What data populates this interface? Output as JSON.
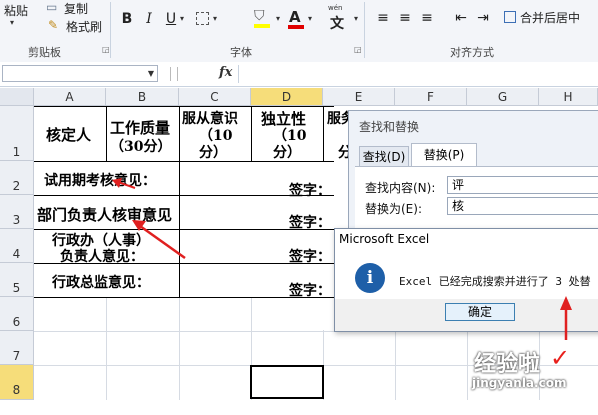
{
  "ribbon": {
    "clipboard": {
      "copy_label": "复制",
      "paste_label": "粘贴",
      "format_painter_label": "格式刷",
      "group_label": "剪贴板"
    },
    "font": {
      "bold": "B",
      "italic": "I",
      "underline": "U",
      "font_color_glyph": "A",
      "phonetic_top": "wén",
      "phonetic_glyph": "文",
      "group_label": "字体"
    },
    "alignment": {
      "merge_center_label": "合并后居中",
      "group_label": "对齐方式"
    }
  },
  "formula_bar": {
    "fx_label": "fx",
    "name_box_value": "",
    "content": ""
  },
  "sheet": {
    "columns": [
      "A",
      "B",
      "C",
      "D",
      "E",
      "F",
      "G",
      "H"
    ],
    "rows": [
      "1",
      "2",
      "3",
      "4",
      "5",
      "6",
      "7",
      "8"
    ],
    "header_row": {
      "a1": "核定人",
      "b1_line1": "工作质量",
      "b1_line2": "（30分）",
      "c1_line1": "服从意识",
      "c1_line2": "（10",
      "c1_line3": "分）",
      "d1_line1": "独立性",
      "d1_line2": "（10",
      "d1_line3": "分）",
      "e1_line1": "服务",
      "e1_line2": "分"
    },
    "rows_content": {
      "r2_label": "试用期考核意见：",
      "r3_label": "部门负责人核审意见",
      "r4_line1": "行政办（人事）",
      "r4_line2": "负责人意见：",
      "r5_label": "行政总监意见：",
      "signature": "签字："
    }
  },
  "find_replace_dialog": {
    "title": "查找和替换",
    "tab_find": "查找(D)",
    "tab_replace": "替换(P)",
    "find_label": "查找内容(N):",
    "find_value": "评",
    "replace_label": "替换为(E):",
    "replace_value": "核"
  },
  "message_box": {
    "title": "Microsoft Excel",
    "icon_glyph": "i",
    "message": "Excel 已经完成搜索并进行了 3 处替",
    "ok_label": "确定"
  },
  "watermark": {
    "brand": "经验啦",
    "url": "jingyanla.com"
  },
  "colors": {
    "arrow_red": "#e02020",
    "header_yellow": "#f6dd7a",
    "dialog_blue": "#1e5fa8",
    "check_red": "#e8201c"
  }
}
